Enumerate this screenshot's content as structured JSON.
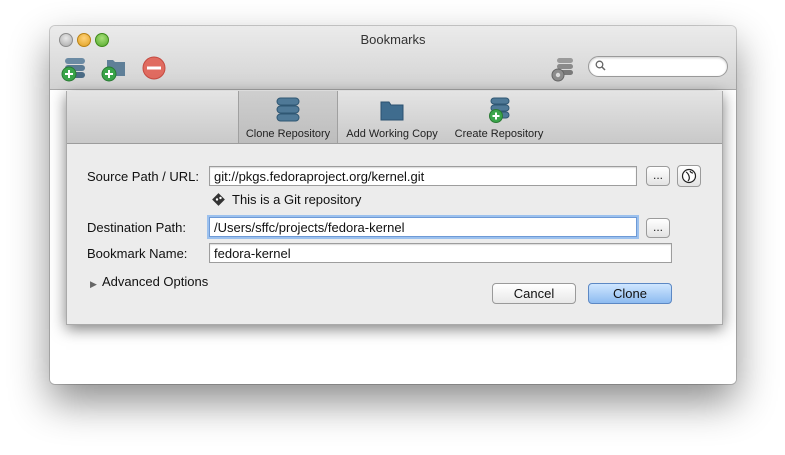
{
  "window": {
    "title": "Bookmarks"
  },
  "search": {
    "placeholder": ""
  },
  "dialog": {
    "tabs": [
      {
        "label": "Clone Repository",
        "selected": true
      },
      {
        "label": "Add Working Copy",
        "selected": false
      },
      {
        "label": "Create Repository",
        "selected": false
      }
    ],
    "source": {
      "label": "Source Path / URL:",
      "value": "git://pkgs.fedoraproject.org/kernel.git",
      "browse_label": "...",
      "repo_note": "This is a Git repository"
    },
    "destination": {
      "label": "Destination Path:",
      "value": "/Users/sffc/projects/fedora-kernel",
      "browse_label": "..."
    },
    "bookmark": {
      "label": "Bookmark Name:",
      "value": "fedora-kernel"
    },
    "advanced_label": "Advanced Options",
    "cancel_label": "Cancel",
    "clone_label": "Clone"
  },
  "colors": {
    "accent": "#8dbbf0",
    "focus_ring": "#9cc1ee",
    "toolbar_green": "#4caf50",
    "toolbar_red": "#e04b3e",
    "db_blue": "#3d6d8e"
  }
}
